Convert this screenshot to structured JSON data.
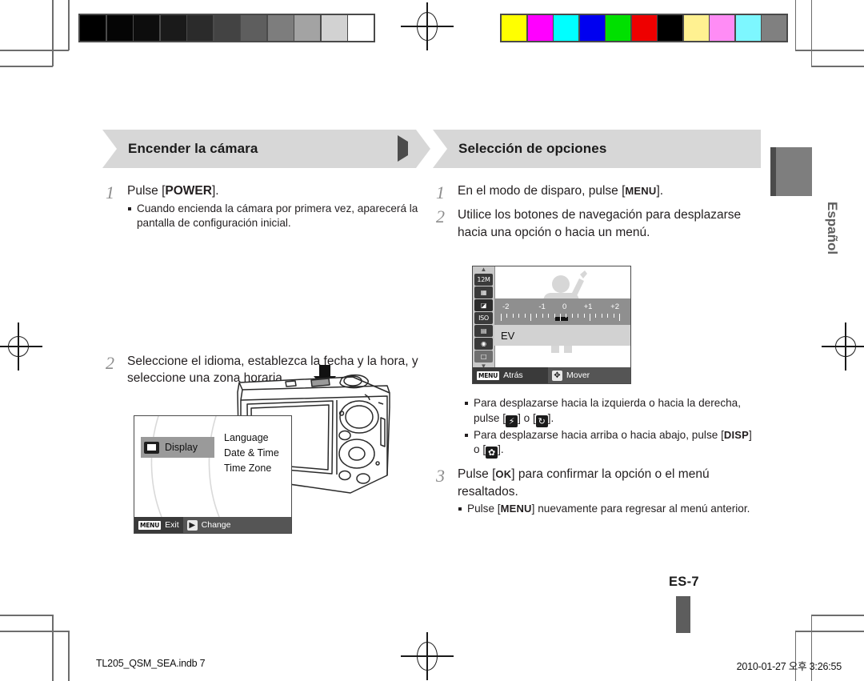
{
  "document": {
    "language_tab": "Español",
    "page_number": "ES-7",
    "footer_file": "TL205_QSM_SEA.indb   7",
    "footer_timestamp": "2010-01-27   오후 3:26:55"
  },
  "calibration": {
    "grayscale": [
      "#000000",
      "#050505",
      "#0d0d0d",
      "#1a1a1a",
      "#2b2b2b",
      "#434343",
      "#5e5e5e",
      "#7d7d7d",
      "#a3a3a3",
      "#d2d2d2",
      "#ffffff"
    ],
    "colors": [
      "#ffff00",
      "#ff00ff",
      "#00ffff",
      "#0000f0",
      "#00e000",
      "#ee0000",
      "#000000",
      "#fff191",
      "#ff8cf5",
      "#7df7ff",
      "#808080"
    ]
  },
  "left_column": {
    "header": {
      "title": "Encender la cámara",
      "glyph": "triangle-right-icon"
    },
    "steps": [
      {
        "number": "1",
        "text_before": "Pulse [",
        "key": "POWER",
        "text_after": "].",
        "bullets": [
          "Cuando encienda la cámara por primera vez, aparecerá la pantalla de configuración inicial."
        ]
      },
      {
        "number": "2",
        "text": "Seleccione el idioma, establezca la fecha y la hora, y seleccione una zona horaria.",
        "bullets": []
      }
    ],
    "camera_illustration": {
      "caption": "camera-rear-line-art",
      "arrow": "down-arrow-to-power-button"
    },
    "lcd_display_menu": {
      "selected_item": "Display",
      "selected_icon": "display-icon",
      "options": [
        "Language",
        "Date & Time",
        "Time Zone"
      ],
      "footer_left_key": "MENU",
      "footer_left_label": "Exit",
      "footer_right_key": "right-arrow-icon",
      "footer_right_label": "Change"
    }
  },
  "right_column": {
    "header": {
      "title": "Selección de opciones",
      "glyph": "square-icon"
    },
    "steps": [
      {
        "number": "1",
        "text_before": "En el modo de disparo, pulse [",
        "key": "MENU",
        "text_after": "]."
      },
      {
        "number": "2",
        "text": "Utilice los botones de navegación para desplazarse hacia una opción o hacia un menú."
      },
      {
        "number": "3",
        "text_before": "Pulse [",
        "key": "OK",
        "text_after": "] para confirmar la opción o el menú resaltados.",
        "bullets_prefix": "Pulse [",
        "bullets_key": "MENU",
        "bullets_suffix": "] nuevamente para regresar al menú anterior."
      }
    ],
    "nav_bullets": [
      {
        "part1": "Para desplazarse hacia la izquierda o hacia la derecha, pulse [",
        "icon1": "flash-icon",
        "mid": "] o [",
        "icon2": "timer-icon",
        "part2": "]."
      },
      {
        "part1": "Para desplazarse hacia arriba o hacia abajo, pulse [",
        "icon1": "DISP",
        "mid": "] o [",
        "icon2": "macro-icon",
        "part2": "]."
      }
    ],
    "lcd_ev_screen": {
      "sidebar_icons": [
        "12M",
        "quality-icon",
        "ev-icon",
        "ISO",
        "wb-icon",
        "face-detect-off-icon",
        "focus-area-icon"
      ],
      "resolution_label": "12M",
      "iso_label": "ISO",
      "selected_row_label": "EV",
      "scale_labels": [
        "-2",
        "-1",
        "0",
        "+1",
        "+2"
      ],
      "scale_value": "0",
      "footer_left_key": "MENU",
      "footer_left_label": "Atrás",
      "footer_right_key": "dpad-icon",
      "footer_right_label": "Mover"
    }
  }
}
